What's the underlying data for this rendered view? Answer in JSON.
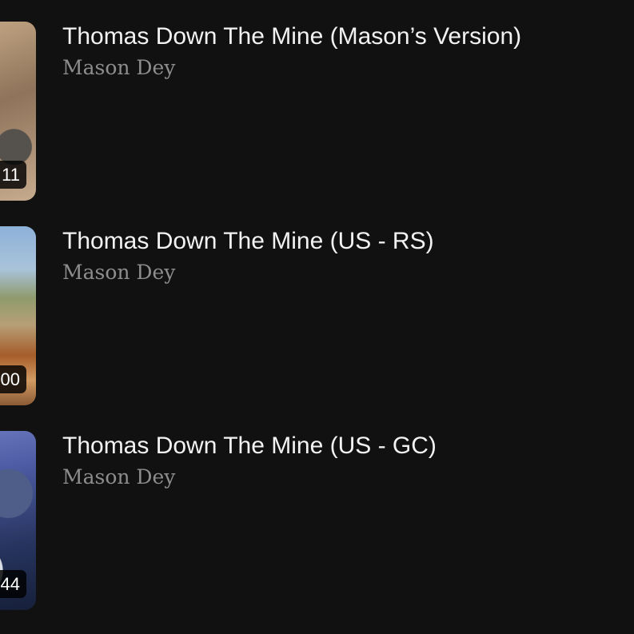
{
  "items": [
    {
      "title": "Thomas Down The Mine (Mason’s Version)",
      "artist": "Mason Dey",
      "duration": "11"
    },
    {
      "title": "Thomas Down The Mine (US - RS)",
      "artist": "Mason Dey",
      "duration": "00"
    },
    {
      "title": "Thomas Down The Mine (US - GC)",
      "artist": "Mason Dey",
      "duration": "44"
    }
  ]
}
